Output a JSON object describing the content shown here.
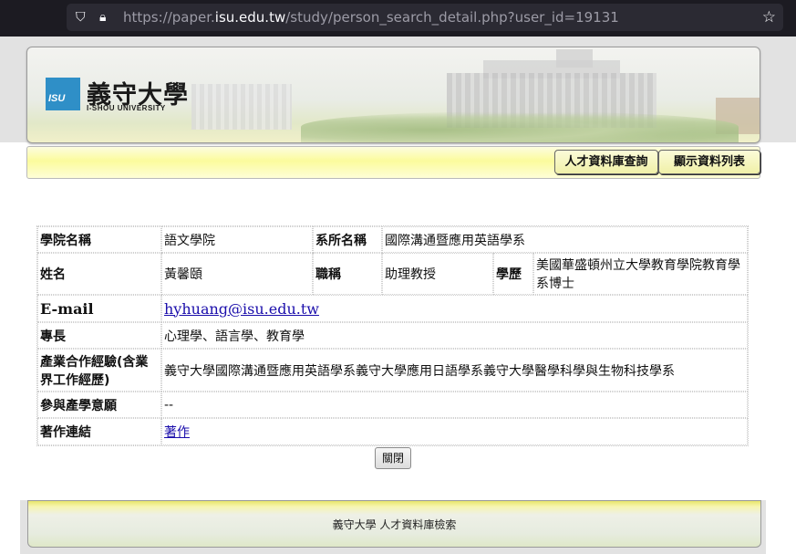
{
  "browser": {
    "url_prefix": "https://paper.",
    "url_host": "isu.edu.tw",
    "url_path": "/study/person_search_detail.php?user_id=19131"
  },
  "header": {
    "logo_abbr": "ISU",
    "logo_cn": "義守大學",
    "logo_en": "I-SHOU UNIVERSITY"
  },
  "nav": {
    "search_label": "人才資料庫查詢",
    "list_label": "顯示資料列表"
  },
  "profile": {
    "college_label": "學院名稱",
    "college_value": "語文學院",
    "dept_label": "系所名稱",
    "dept_value": "國際溝通暨應用英語學系",
    "name_label": "姓名",
    "name_value": "黃馨頤",
    "title_label": "職稱",
    "title_value": "助理教授",
    "degree_label": "學歷",
    "degree_value": "美國華盛頓州立大學教育學院教育學系博士",
    "email_label": "E-mail",
    "email_value": "hyhuang@isu.edu.tw",
    "expertise_label": "專長",
    "expertise_value": "心理學、語言學、教育學",
    "industry_label": "產業合作經驗(含業界工作經歷)",
    "industry_value": "義守大學國際溝通暨應用英語學系義守大學應用日語學系義守大學醫學科學與生物科技學系",
    "willingness_label": "參與產學意願",
    "willingness_value": "--",
    "works_label": "著作連結",
    "works_value": "著作"
  },
  "close_label": "關閉",
  "footer": {
    "text": "義守大學 人才資料庫檢索"
  }
}
